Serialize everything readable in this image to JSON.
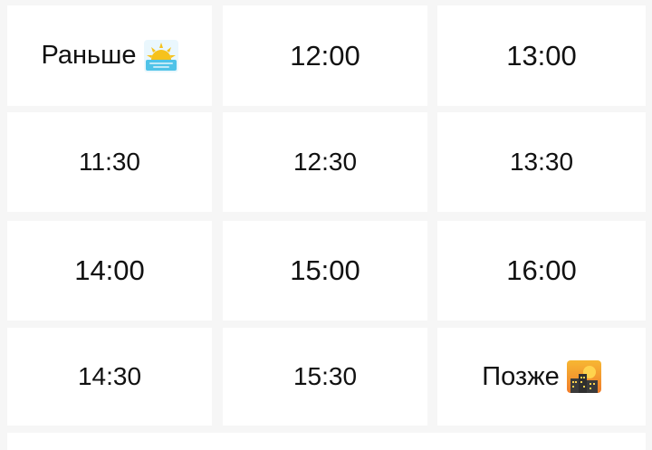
{
  "slots": {
    "earlier": {
      "label": "Раньше",
      "icon": "sunrise-icon"
    },
    "t1200": "12:00",
    "t1300": "13:00",
    "t1130": "11:30",
    "t1230": "12:30",
    "t1330": "13:30",
    "t1400": "14:00",
    "t1500": "15:00",
    "t1600": "16:00",
    "t1430": "14:30",
    "t1530": "15:30",
    "later": {
      "label": "Позже",
      "icon": "city-sunset-icon"
    }
  },
  "colors": {
    "background": "#f6f6f6",
    "cell": "#ffffff",
    "text": "#111111",
    "sun": "#f6c21c",
    "water": "#4fc3e8",
    "sunset_sky": "#f59a2e",
    "building": "#3b3b3b"
  }
}
